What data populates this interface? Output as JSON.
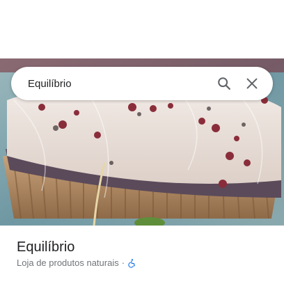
{
  "search": {
    "query": "Equilíbrio",
    "search_icon": "search-icon",
    "close_icon": "close-icon"
  },
  "photo": {
    "subject": "place-photo",
    "colors": {
      "background": "#7fa8b0",
      "cake": "#e8ddd6",
      "base": "#6a5a68",
      "paper": "#b08a62"
    }
  },
  "place": {
    "title": "Equilíbrio",
    "category": "Loja de produtos naturais",
    "separator": "·",
    "accessibility_icon": "wheelchair-icon",
    "accessibility_color": "#1a73e8"
  }
}
